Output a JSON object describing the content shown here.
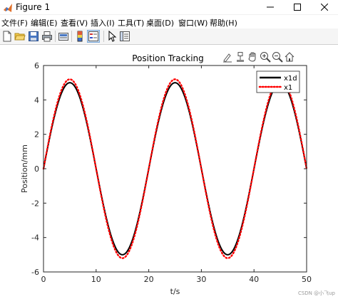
{
  "window": {
    "title": "Figure 1"
  },
  "menu": [
    {
      "label": "文件(F)"
    },
    {
      "label": "编辑(E)"
    },
    {
      "label": "查看(V)"
    },
    {
      "label": "插入(I)"
    },
    {
      "label": "工具(T)"
    },
    {
      "label": "桌面(D)"
    },
    {
      "label": "窗口(W)"
    },
    {
      "label": "帮助(H)"
    }
  ],
  "toolbar": [
    "new-figure-icon",
    "open-folder-icon",
    "save-icon",
    "print-icon",
    "link-icon",
    "colorbar-icon",
    "legend-icon",
    "pointer-icon",
    "property-inspector-icon"
  ],
  "axes_toolbar": [
    "brush-icon",
    "data-cursor-icon",
    "pan-icon",
    "zoom-in-icon",
    "zoom-out-icon",
    "home-icon"
  ],
  "colors": {
    "reference": "#000000",
    "tracked": "#ff0000"
  },
  "watermark": "CSDN @小飞up",
  "chart_data": {
    "type": "line",
    "title": "Position Tracking",
    "xlabel": "t/s",
    "ylabel": "Position/mm",
    "xlim": [
      0,
      50
    ],
    "ylim": [
      -6,
      6
    ],
    "xticks": [
      "0",
      "10",
      "20",
      "30",
      "40",
      "50"
    ],
    "yticks": [
      "6",
      "4",
      "2",
      "0",
      "-2",
      "-4",
      "-6"
    ],
    "legend_position": "top-right",
    "series": [
      {
        "name": "x1d",
        "style": "solid",
        "color": "#000000",
        "amplitude": 5,
        "period": 20,
        "x_start": 0,
        "x_end": 50
      },
      {
        "name": "x1",
        "style": "dotted",
        "color": "#ff0000",
        "amplitude": 5.2,
        "period": 20,
        "x_start": 0,
        "x_end": 50
      }
    ]
  }
}
